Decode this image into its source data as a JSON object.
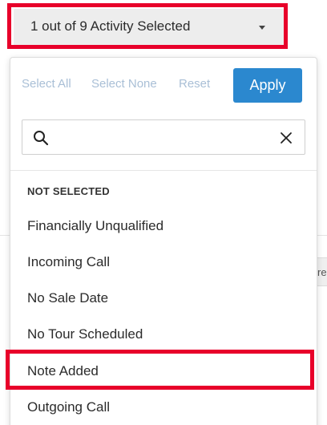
{
  "dropdown": {
    "summary_label": "1 out of 9 Activity Selected"
  },
  "panel": {
    "select_all": "Select All",
    "select_none": "Select None",
    "reset": "Reset",
    "apply": "Apply",
    "search": {
      "value": "",
      "placeholder": ""
    },
    "section_header": "NOT SELECTED",
    "options": [
      "Financially Unqualified",
      "Incoming Call",
      "No Sale Date",
      "No Tour Scheduled",
      "Note Added",
      "Outgoing Call"
    ]
  },
  "background": {
    "partial_chip_text": "re"
  },
  "colors": {
    "highlight": "#e8002a",
    "apply_button": "#2b88cf",
    "link_muted": "#a9bfd6"
  }
}
